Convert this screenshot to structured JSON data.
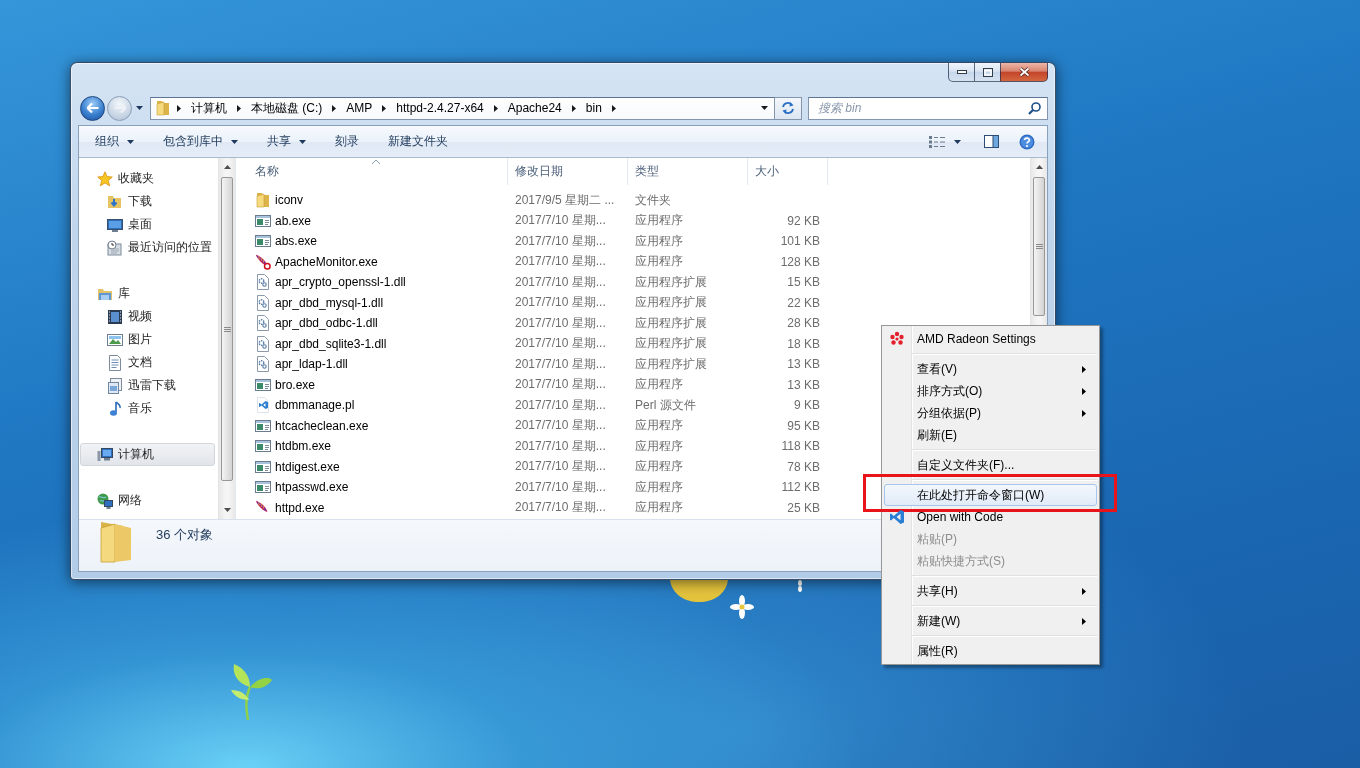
{
  "navigation": {
    "back_disabled": false,
    "forward_disabled": true
  },
  "address_bar": {
    "breadcrumbs": [
      "计算机",
      "本地磁盘 (C:)",
      "AMP",
      "httpd-2.4.27-x64",
      "Apache24",
      "bin"
    ]
  },
  "search": {
    "placeholder": "搜索 bin"
  },
  "toolbar": {
    "buttons": [
      {
        "label": "组织",
        "dropdown": true
      },
      {
        "label": "包含到库中",
        "dropdown": true
      },
      {
        "label": "共享",
        "dropdown": true
      },
      {
        "label": "刻录",
        "dropdown": false
      },
      {
        "label": "新建文件夹",
        "dropdown": false
      }
    ]
  },
  "sidebar": {
    "groups": [
      {
        "label": "收藏夹",
        "selected": false,
        "children": [
          {
            "label": "下载",
            "selected": false
          },
          {
            "label": "桌面",
            "selected": false
          },
          {
            "label": "最近访问的位置",
            "selected": false
          }
        ]
      },
      {
        "label": "库",
        "selected": false,
        "children": [
          {
            "label": "视频",
            "selected": false
          },
          {
            "label": "图片",
            "selected": false
          },
          {
            "label": "文档",
            "selected": false
          },
          {
            "label": "迅雷下载",
            "selected": false
          },
          {
            "label": "音乐",
            "selected": false
          }
        ]
      },
      {
        "label": "计算机",
        "selected": true
      },
      {
        "label": "网络",
        "selected": false
      }
    ]
  },
  "file_list": {
    "columns": [
      {
        "label": "名称",
        "sorted": true
      },
      {
        "label": "修改日期",
        "sorted": false
      },
      {
        "label": "类型",
        "sorted": false
      },
      {
        "label": "大小",
        "sorted": false
      }
    ],
    "rows": [
      {
        "kind": "folder",
        "name": "iconv",
        "modified": "2017/9/5 星期二 ...",
        "type": "文件夹"
      },
      {
        "kind": "program",
        "name": "ab.exe",
        "modified": "2017/7/10 星期...",
        "type": "应用程序",
        "size": "92 KB"
      },
      {
        "kind": "program",
        "name": "abs.exe",
        "modified": "2017/7/10 星期...",
        "type": "应用程序",
        "size": "101 KB"
      },
      {
        "kind": "program_monitor",
        "name": "ApacheMonitor.exe",
        "modified": "2017/7/10 星期...",
        "type": "应用程序",
        "size": "128 KB"
      },
      {
        "kind": "library",
        "name": "apr_crypto_openssl-1.dll",
        "modified": "2017/7/10 星期...",
        "type": "应用程序扩展",
        "size": "15 KB"
      },
      {
        "kind": "library",
        "name": "apr_dbd_mysql-1.dll",
        "modified": "2017/7/10 星期...",
        "type": "应用程序扩展",
        "size": "22 KB"
      },
      {
        "kind": "library",
        "name": "apr_dbd_odbc-1.dll",
        "modified": "2017/7/10 星期...",
        "type": "应用程序扩展",
        "size": "28 KB"
      },
      {
        "kind": "library",
        "name": "apr_dbd_sqlite3-1.dll",
        "modified": "2017/7/10 星期...",
        "type": "应用程序扩展",
        "size": "18 KB"
      },
      {
        "kind": "library",
        "name": "apr_ldap-1.dll",
        "modified": "2017/7/10 星期...",
        "type": "应用程序扩展",
        "size": "13 KB"
      },
      {
        "kind": "program",
        "name": "bro.exe",
        "modified": "2017/7/10 星期...",
        "type": "应用程序",
        "size": "13 KB"
      },
      {
        "kind": "script",
        "name": "dbmmanage.pl",
        "modified": "2017/7/10 星期...",
        "type": "Perl 源文件",
        "size": "9 KB"
      },
      {
        "kind": "program",
        "name": "htcacheclean.exe",
        "modified": "2017/7/10 星期...",
        "type": "应用程序",
        "size": "95 KB"
      },
      {
        "kind": "program",
        "name": "htdbm.exe",
        "modified": "2017/7/10 星期...",
        "type": "应用程序",
        "size": "118 KB"
      },
      {
        "kind": "program",
        "name": "htdigest.exe",
        "modified": "2017/7/10 星期...",
        "type": "应用程序",
        "size": "78 KB"
      },
      {
        "kind": "program",
        "name": "htpasswd.exe",
        "modified": "2017/7/10 星期...",
        "type": "应用程序",
        "size": "112 KB"
      },
      {
        "kind": "program_server",
        "name": "httpd.exe",
        "modified": "2017/7/10 星期...",
        "type": "应用程序",
        "size": "25 KB"
      }
    ]
  },
  "status_bar": {
    "text": "36 个对象"
  },
  "context_menu": {
    "items": [
      {
        "kind": "item",
        "label": "AMD Radeon Settings",
        "submenu": false,
        "disabled": false,
        "selected": false,
        "annotated": false
      },
      {
        "kind": "separator"
      },
      {
        "kind": "item",
        "label": "查看(V)",
        "submenu": true,
        "disabled": false,
        "selected": false,
        "annotated": false
      },
      {
        "kind": "item",
        "label": "排序方式(O)",
        "submenu": true,
        "disabled": false,
        "selected": false,
        "annotated": false
      },
      {
        "kind": "item",
        "label": "分组依据(P)",
        "submenu": true,
        "disabled": false,
        "selected": false,
        "annotated": false
      },
      {
        "kind": "item",
        "label": "刷新(E)",
        "submenu": false,
        "disabled": false,
        "selected": false,
        "annotated": false
      },
      {
        "kind": "separator"
      },
      {
        "kind": "item",
        "label": "自定义文件夹(F)...",
        "submenu": false,
        "disabled": false,
        "selected": false,
        "annotated": false
      },
      {
        "kind": "separator"
      },
      {
        "kind": "item",
        "label": "在此处打开命令窗口(W)",
        "submenu": false,
        "disabled": false,
        "selected": true,
        "annotated": true
      },
      {
        "kind": "item",
        "label": "Open with Code",
        "submenu": false,
        "disabled": false,
        "selected": false,
        "annotated": false
      },
      {
        "kind": "item",
        "label": "粘贴(P)",
        "submenu": false,
        "disabled": true,
        "selected": false,
        "annotated": false
      },
      {
        "kind": "item",
        "label": "粘贴快捷方式(S)",
        "submenu": false,
        "disabled": true,
        "selected": false,
        "annotated": false
      },
      {
        "kind": "separator"
      },
      {
        "kind": "item",
        "label": "共享(H)",
        "submenu": true,
        "disabled": false,
        "selected": false,
        "annotated": false
      },
      {
        "kind": "separator"
      },
      {
        "kind": "item",
        "label": "新建(W)",
        "submenu": true,
        "disabled": false,
        "selected": false,
        "annotated": false
      },
      {
        "kind": "separator"
      },
      {
        "kind": "item",
        "label": "属性(R)",
        "submenu": false,
        "disabled": false,
        "selected": false,
        "annotated": false
      }
    ]
  }
}
